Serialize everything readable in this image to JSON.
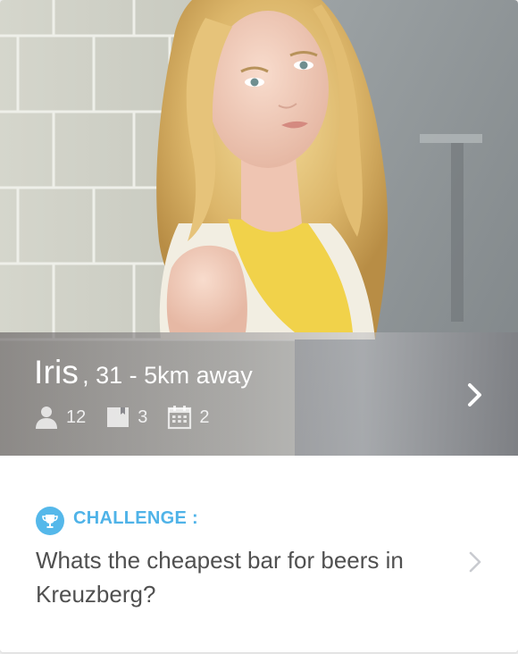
{
  "profile": {
    "name": "Iris",
    "age_distance": ", 31 - 5km away",
    "stats": [
      {
        "icon": "person-icon",
        "count": "12"
      },
      {
        "icon": "book-icon",
        "count": "3"
      },
      {
        "icon": "calendar-icon",
        "count": "2"
      }
    ]
  },
  "challenge": {
    "label": "CHALLENGE :",
    "question": "Whats the cheapest bar for beers in Kreuzberg?"
  },
  "colors": {
    "accent": "#4fb3e8",
    "text_dark": "#505050",
    "white": "#ffffff"
  },
  "icons": {
    "open": "chevron-right-icon",
    "challenge": "trophy-icon"
  }
}
